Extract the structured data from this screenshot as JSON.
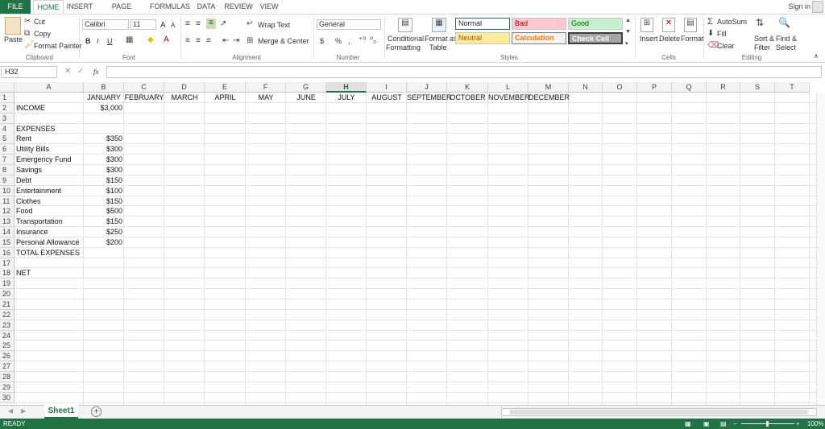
{
  "tabs": {
    "file": "FILE",
    "home": "HOME",
    "insert": "INSERT",
    "page_layout": "PAGE LAYOUT",
    "formulas": "FORMULAS",
    "data": "DATA",
    "review": "REVIEW",
    "view": "VIEW",
    "sign_in": "Sign in"
  },
  "ribbon": {
    "clipboard": {
      "paste": "Paste",
      "cut": "Cut",
      "copy": "Copy",
      "format_painter": "Format Painter",
      "label": "Clipboard"
    },
    "font": {
      "name": "Calibri",
      "size": "11",
      "bold": "B",
      "italic": "I",
      "underline": "U",
      "grow": "A",
      "shrink": "A",
      "label": "Font"
    },
    "alignment": {
      "wrap_text": "Wrap Text",
      "merge_center": "Merge & Center",
      "label": "Alignment"
    },
    "number": {
      "format": "General",
      "currency": "$",
      "percent": "%",
      "comma": ",",
      "label": "Number"
    },
    "styles": {
      "conditional": "Conditional",
      "formatting": "Formatting",
      "format_as": "Format as",
      "table": "Table",
      "normal": "Normal",
      "bad": "Bad",
      "good": "Good",
      "neutral": "Neutral",
      "calculation": "Calculation",
      "check_cell": "Check Cell",
      "label": "Styles"
    },
    "cells": {
      "insert": "Insert",
      "delete": "Delete",
      "format": "Format",
      "label": "Cells"
    },
    "editing": {
      "autosum": "AutoSum",
      "fill": "Fill",
      "clear": "Clear",
      "sort_filter_1": "Sort &",
      "sort_filter_2": "Filter",
      "find_select_1": "Find &",
      "find_select_2": "Select",
      "label": "Editing"
    }
  },
  "formula_bar": {
    "name_box": "H32",
    "fx": "fx",
    "value": ""
  },
  "columns": [
    "A",
    "B",
    "C",
    "D",
    "E",
    "F",
    "G",
    "H",
    "I",
    "J",
    "K",
    "L",
    "M",
    "N",
    "O",
    "P",
    "Q",
    "R",
    "S",
    "T"
  ],
  "selected_column": "H",
  "rows": [
    "1",
    "2",
    "3",
    "4",
    "5",
    "6",
    "7",
    "8",
    "9",
    "10",
    "11",
    "12",
    "13",
    "14",
    "15",
    "16",
    "17",
    "18",
    "19",
    "20",
    "21",
    "22",
    "23",
    "24",
    "25",
    "26",
    "27",
    "28",
    "29",
    "30"
  ],
  "months": [
    "JANUARY",
    "FEBRUARY",
    "MARCH",
    "APRIL",
    "MAY",
    "JUNE",
    "JULY",
    "AUGUST",
    "SEPTEMBER",
    "OCTOBER",
    "NOVEMBER",
    "DECEMBER"
  ],
  "labels": {
    "income": "INCOME",
    "expenses": "EXPENSES",
    "total_expenses": "TOTAL EXPENSES",
    "net": "NET"
  },
  "income_value": "$3,000",
  "expenses": [
    {
      "name": "Rent",
      "value": "$350"
    },
    {
      "name": "Utility Bills",
      "value": "$300"
    },
    {
      "name": "Emergency Fund",
      "value": "$300"
    },
    {
      "name": "Savings",
      "value": "$300"
    },
    {
      "name": "Debt",
      "value": "$150"
    },
    {
      "name": "Entertainment",
      "value": "$100"
    },
    {
      "name": "Clothes",
      "value": "$150"
    },
    {
      "name": "Food",
      "value": "$500"
    },
    {
      "name": "Transportation",
      "value": "$150"
    },
    {
      "name": "Insurance",
      "value": "$250"
    },
    {
      "name": "Personal Allowance",
      "value": "$200"
    }
  ],
  "sheet_tab": "Sheet1",
  "status": {
    "ready": "READY",
    "zoom": "100%"
  },
  "colors": {
    "excel_green": "#217346"
  }
}
